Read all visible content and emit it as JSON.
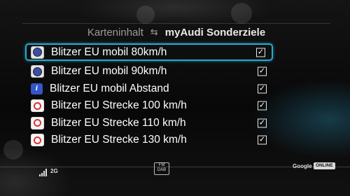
{
  "header": {
    "inactive_tab": "Karteninhalt",
    "active_tab": "myAudi Sonderziele"
  },
  "list": [
    {
      "icon": "speed-camera-icon",
      "badge": "",
      "label": "Blitzer EU mobil 80km/h",
      "checked": true,
      "selected": true
    },
    {
      "icon": "speed-camera-icon",
      "badge": "",
      "label": "Blitzer EU mobil 90km/h",
      "checked": true,
      "selected": false
    },
    {
      "icon": "info-icon",
      "badge": "i",
      "label": "Blitzer EU mobil Abstand",
      "checked": true,
      "selected": false
    },
    {
      "icon": "section-control-icon",
      "badge": "",
      "label": "Blitzer EU Strecke 100 km/h",
      "checked": true,
      "selected": false
    },
    {
      "icon": "section-control-icon",
      "badge": "",
      "label": "Blitzer EU Strecke 110 km/h",
      "checked": true,
      "selected": false
    },
    {
      "icon": "section-control-icon",
      "badge": "",
      "label": "Blitzer EU Strecke 130 km/h",
      "checked": true,
      "selected": false
    }
  ],
  "status": {
    "network": "2G",
    "radio_top": "FM",
    "radio_bottom": "DAB",
    "map_provider": "Google",
    "online": "ONLINE"
  },
  "colors": {
    "accent": "#2aa8c9",
    "text": "#ffffff",
    "muted": "#9a9a9a"
  }
}
